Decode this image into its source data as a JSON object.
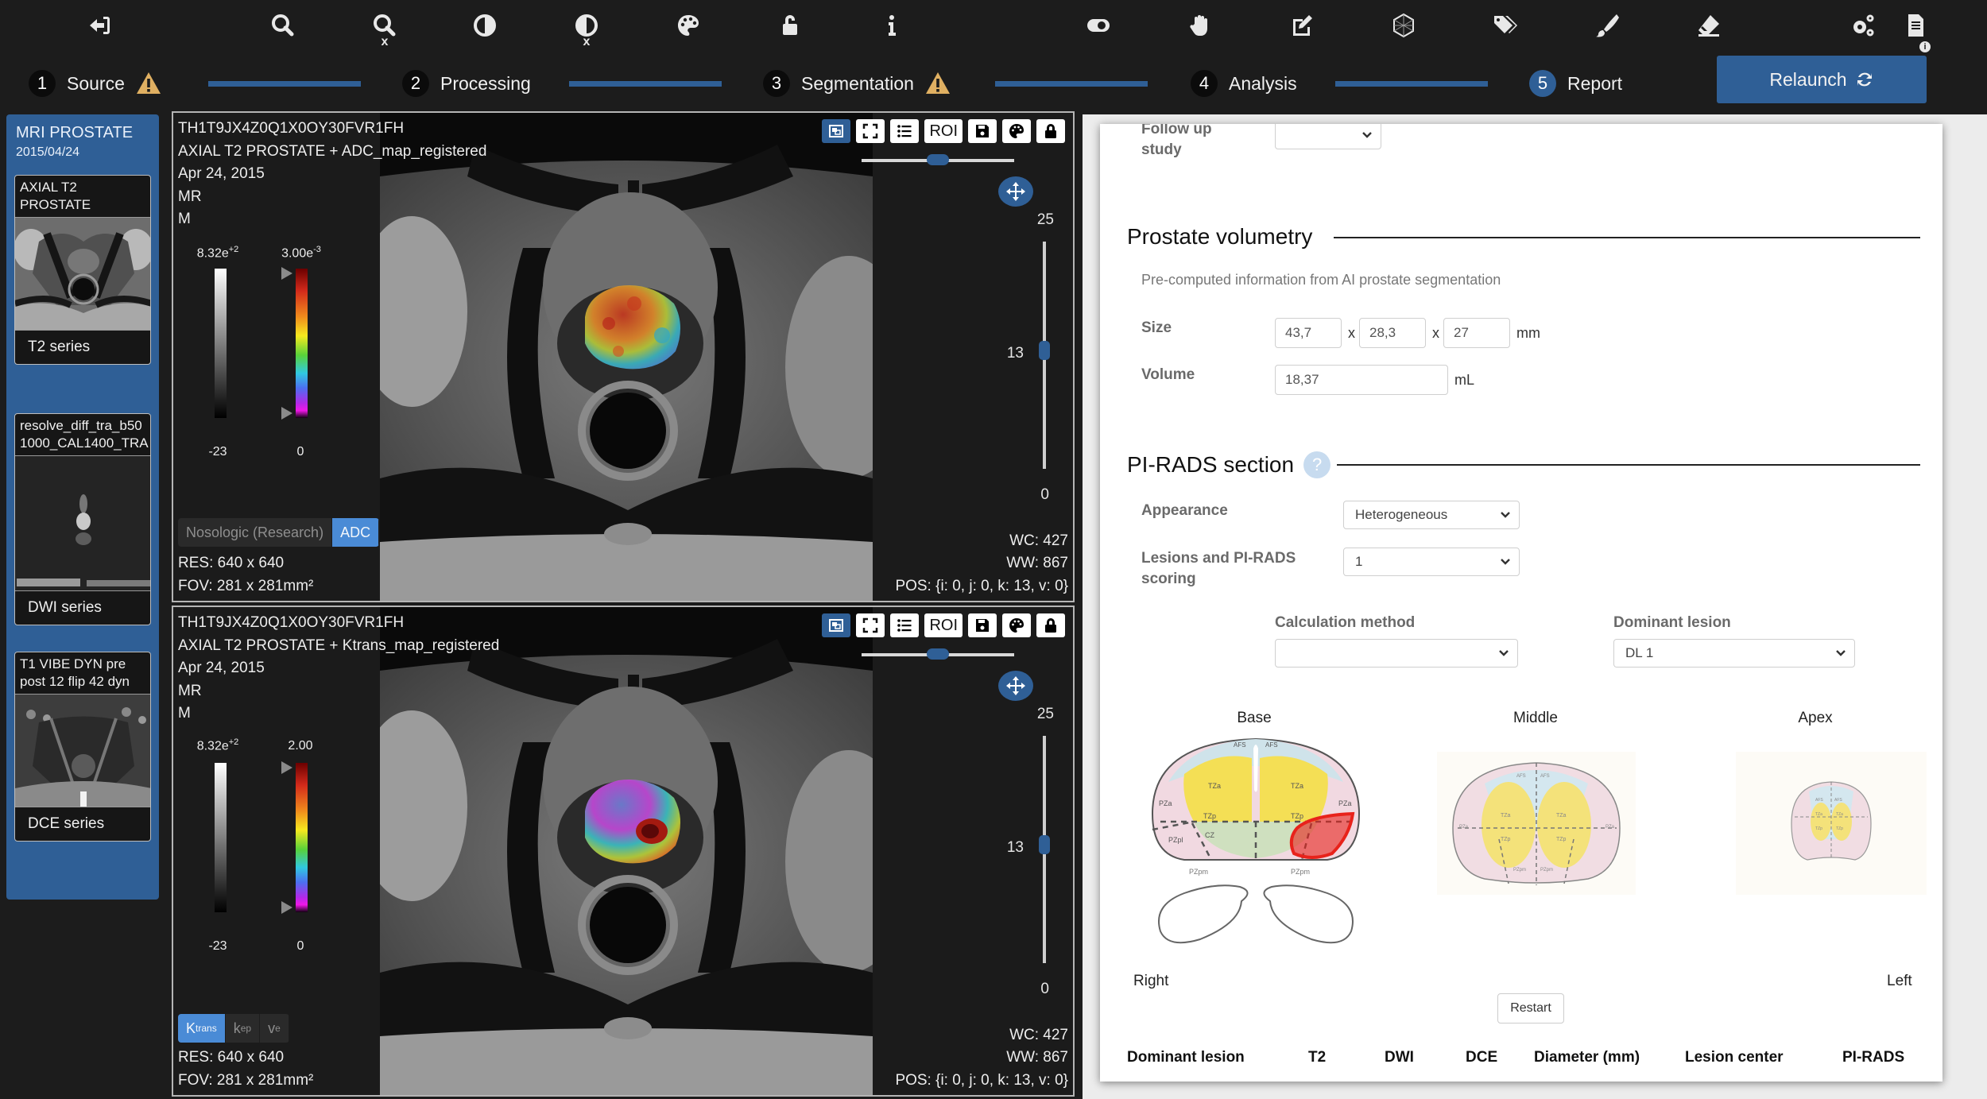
{
  "toolbar": {
    "tools": [
      {
        "name": "exit-icon"
      },
      {
        "name": "zoom-icon"
      },
      {
        "name": "reset-zoom-icon",
        "sub": "x"
      },
      {
        "name": "contrast-icon"
      },
      {
        "name": "reset-contrast-icon",
        "sub": "x"
      },
      {
        "name": "palette-icon"
      },
      {
        "name": "unlock-icon"
      },
      {
        "name": "info-icon"
      },
      {
        "name": "toggle-icon"
      },
      {
        "name": "hand-pan-icon"
      },
      {
        "name": "edit-icon"
      },
      {
        "name": "3d-mesh-icon"
      },
      {
        "name": "tags-icon"
      },
      {
        "name": "brush-icon"
      },
      {
        "name": "eraser-icon"
      },
      {
        "name": "settings-icon"
      },
      {
        "name": "document-info-icon"
      }
    ]
  },
  "stepper": {
    "steps": [
      {
        "num": "1",
        "label": "Source",
        "warning": true
      },
      {
        "num": "2",
        "label": "Processing",
        "warning": false
      },
      {
        "num": "3",
        "label": "Segmentation",
        "warning": true
      },
      {
        "num": "4",
        "label": "Analysis",
        "warning": false
      },
      {
        "num": "5",
        "label": "Report",
        "warning": false,
        "active": true
      }
    ],
    "relaunch_label": "Relaunch"
  },
  "sidebar": {
    "study_title": "MRI PROSTATE",
    "study_date": "2015/04/24",
    "series": [
      {
        "name_lines": [
          "AXIAL T2",
          "PROSTATE"
        ],
        "type": "T2 series"
      },
      {
        "name_lines": [
          "resolve_diff_tra_b50",
          "1000_CAL1400_TRA"
        ],
        "type": "DWI series"
      },
      {
        "name_lines": [
          "T1 VIBE DYN pre",
          "post 12 flip 42 dyn"
        ],
        "type": "DCE series"
      }
    ]
  },
  "viewers": [
    {
      "id": "TH1T9JX4Z0Q1X0OY30FVR1FH",
      "series": "AXIAL T2 PROSTATE + ADC_map_registered",
      "date": "Apr 24, 2015",
      "modality": "MR",
      "sex": "M",
      "gray_max": "8.32e",
      "gray_max_exp": "+2",
      "gray_min": "-23",
      "color_max": "3.00e",
      "color_max_exp": "-3",
      "color_min": "0",
      "maps": [
        {
          "label": "Nosologic (Research)",
          "active": false
        },
        {
          "label": "ADC",
          "active": true
        }
      ],
      "res": "RES: 640 x 640",
      "fov": "FOV: 281 x 281mm²",
      "wc": "WC: 427",
      "ww": "WW: 867",
      "pos": "POS: {i: 0, j: 0, k: 13, v: 0}",
      "roi_label": "ROI",
      "slice": {
        "max": "25",
        "current": "13",
        "min": "0",
        "value": 13,
        "range": 25
      },
      "opacity_fraction": 0.5
    },
    {
      "id": "TH1T9JX4Z0Q1X0OY30FVR1FH",
      "series": "AXIAL T2 PROSTATE + Ktrans_map_registered",
      "date": "Apr 24, 2015",
      "modality": "MR",
      "sex": "M",
      "gray_max": "8.32e",
      "gray_max_exp": "+2",
      "gray_min": "-23",
      "color_max": "2.00",
      "color_max_exp": "",
      "color_min": "0",
      "maps": [
        {
          "label": "K",
          "sup": "trans",
          "active": true
        },
        {
          "label": "k",
          "sub": "ep",
          "active": false
        },
        {
          "label": "v",
          "sub": "e",
          "active": false
        }
      ],
      "res": "RES: 640 x 640",
      "fov": "FOV: 281 x 281mm²",
      "wc": "WC: 427",
      "ww": "WW: 867",
      "pos": "POS: {i: 0, j: 0, k: 13, v: 0}",
      "roi_label": "ROI",
      "slice": {
        "max": "25",
        "current": "13",
        "min": "0",
        "value": 13,
        "range": 25
      },
      "opacity_fraction": 0.5
    }
  ],
  "report": {
    "follow_up_label": "Follow up study",
    "follow_up_value": "",
    "volumetry": {
      "heading": "Prostate volumetry",
      "note": "Pre-computed information from AI prostate segmentation",
      "size_label": "Size",
      "size_values": [
        "43,7",
        "28,3",
        "27"
      ],
      "size_sep": "x",
      "size_unit": "mm",
      "volume_label": "Volume",
      "volume_value": "18,37",
      "volume_unit": "mL"
    },
    "pirads": {
      "heading": "PI-RADS section",
      "help": "?",
      "appearance_label": "Appearance",
      "appearance_value": "Heterogeneous",
      "lesions_label": "Lesions and PI-RADS scoring",
      "lesions_value": "1",
      "calc_label": "Calculation method",
      "calc_value": "",
      "dominant_label": "Dominant lesion",
      "dominant_value": "DL 1",
      "maps": [
        {
          "title": "Base"
        },
        {
          "title": "Middle"
        },
        {
          "title": "Apex"
        }
      ],
      "zone_labels": {
        "afs": "AFS",
        "tza": "TZa",
        "tzp": "TZp",
        "pza": "PZa",
        "pzpl": "PZpl",
        "pzpm": "PZpm",
        "cz": "CZ"
      },
      "right_label": "Right",
      "left_label": "Left",
      "restart_label": "Restart",
      "table_headers": [
        "Dominant lesion",
        "T2",
        "DWI",
        "DCE",
        "Diameter (mm)",
        "Lesion center",
        "PI-RADS"
      ]
    }
  },
  "colors": {
    "accent": "#2f5f96",
    "active_map": "#4a8bd6",
    "warning": "#e0b062",
    "lesion": "#e8221b"
  }
}
